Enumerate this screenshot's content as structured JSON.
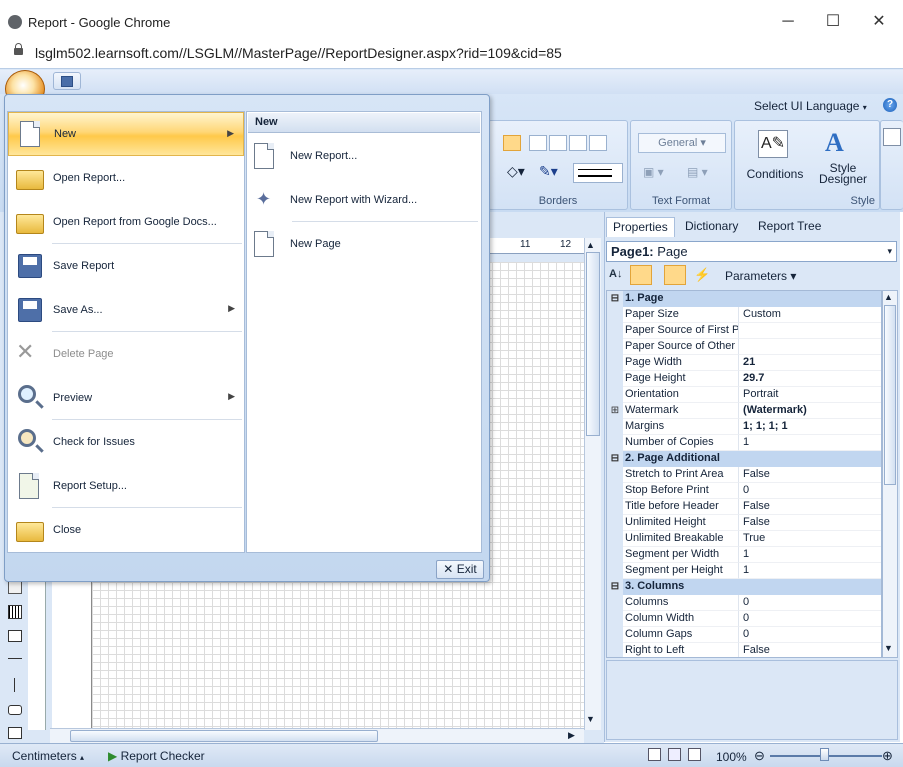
{
  "window": {
    "title": "Report - Google Chrome",
    "url": "lsglm502.learnsoft.com//LSGLM//MasterPage//ReportDesigner.aspx?rid=109&cid=85",
    "minimize": "─",
    "maximize": "☐",
    "close": "✕"
  },
  "ribbon": {
    "language_label": "Select UI Language",
    "groups": {
      "borders": "Borders",
      "text_format": "Text Format",
      "style": "Style"
    },
    "general_format": "General",
    "conditions_label": "Conditions",
    "style_designer_label": "Style Designer"
  },
  "ruler": {
    "tick_11": "11",
    "tick_12": "12"
  },
  "app_menu": {
    "items": [
      {
        "label": "New",
        "icon": "new-document-icon"
      },
      {
        "label": "Open Report...",
        "icon": "open-folder-icon"
      },
      {
        "label": "Open Report from Google Docs...",
        "icon": "google-docs-folder-icon"
      },
      {
        "label": "Save Report",
        "icon": "save-floppy-icon"
      },
      {
        "label": "Save As...",
        "icon": "save-as-icon"
      },
      {
        "label": "Delete Page",
        "icon": "delete-page-icon"
      },
      {
        "label": "Preview",
        "icon": "preview-magnifier-icon"
      },
      {
        "label": "Check for Issues",
        "icon": "check-issues-icon"
      },
      {
        "label": "Report Setup...",
        "icon": "report-setup-icon"
      },
      {
        "label": "Close",
        "icon": "close-folder-icon"
      }
    ],
    "submenu_title": "New",
    "submenu_items": [
      {
        "label": "New Report...",
        "icon": "new-report-icon"
      },
      {
        "label": "New Report with Wizard...",
        "icon": "wizard-wand-icon"
      },
      {
        "label": "New Page",
        "icon": "new-page-icon"
      }
    ],
    "exit_label": "Exit"
  },
  "right_panel": {
    "tabs": [
      "Properties",
      "Dictionary",
      "Report Tree"
    ],
    "selected_object_name": "Page1:",
    "selected_object_type": "Page",
    "parameters_label": "Parameters",
    "categories": [
      {
        "title": "1. Page",
        "rows": [
          {
            "name": "Paper Size",
            "value": "Custom"
          },
          {
            "name": "Paper Source of First P",
            "value": ""
          },
          {
            "name": "Paper Source of Other",
            "value": ""
          },
          {
            "name": "Page Width",
            "value": "21",
            "bold": true
          },
          {
            "name": "Page Height",
            "value": "29.7",
            "bold": true
          },
          {
            "name": "Orientation",
            "value": "Portrait"
          },
          {
            "name": "Watermark",
            "value": "(Watermark)",
            "bold": true,
            "expandable": true
          },
          {
            "name": "Margins",
            "value": "1; 1; 1; 1",
            "bold": true
          },
          {
            "name": "Number of Copies",
            "value": "1"
          }
        ]
      },
      {
        "title": "2. Page Additional",
        "rows": [
          {
            "name": "Stretch to Print Area",
            "value": "False"
          },
          {
            "name": "Stop Before Print",
            "value": "0"
          },
          {
            "name": "Title before Header",
            "value": "False"
          },
          {
            "name": "Unlimited Height",
            "value": "False"
          },
          {
            "name": "Unlimited Breakable",
            "value": "True"
          },
          {
            "name": "Segment per Width",
            "value": "1"
          },
          {
            "name": "Segment per Height",
            "value": "1"
          }
        ]
      },
      {
        "title": "3. Columns",
        "rows": [
          {
            "name": "Columns",
            "value": "0"
          },
          {
            "name": "Column Width",
            "value": "0"
          },
          {
            "name": "Column Gaps",
            "value": "0"
          },
          {
            "name": "Right to Left",
            "value": "False"
          }
        ]
      }
    ]
  },
  "status": {
    "units": "Centimeters",
    "checker": "Report Checker",
    "zoom": "100%"
  },
  "colors": {
    "ribbon_bg": "#d3e2f5",
    "menu_highlight": "#ffd777",
    "category_bg": "#c1d6f0"
  }
}
